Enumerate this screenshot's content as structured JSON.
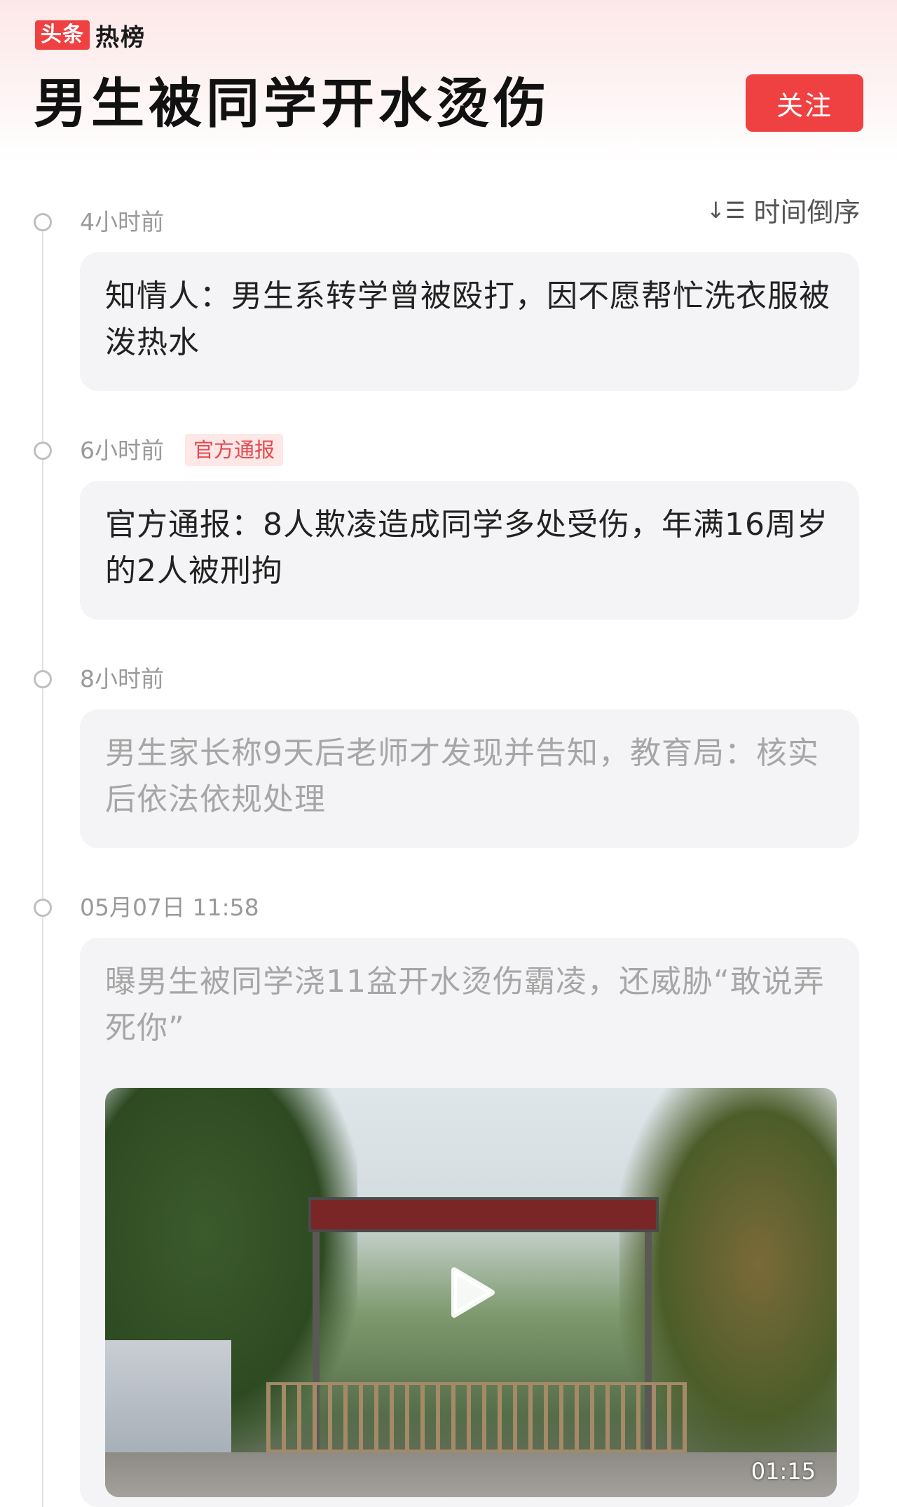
{
  "brand": {
    "tag": "头条",
    "name": "热榜"
  },
  "header": {
    "title": "男生被同学开水烫伤",
    "follow_label": "关注"
  },
  "sort": {
    "label": "时间倒序"
  },
  "timeline": [
    {
      "time": "4小时前",
      "text": "知情人：男生系转学曾被殴打，因不愿帮忙洗衣服被泼热水"
    },
    {
      "time": "6小时前",
      "tag": "官方通报",
      "text": "官方通报：8人欺凌造成同学多处受伤，年满16周岁的2人被刑拘"
    },
    {
      "time": "8小时前",
      "text": "男生家长称9天后老师才发现并告知，教育局：核实后依法依规处理"
    },
    {
      "time": "05月07日 11:58",
      "text": "曝男生被同学浇11盆开水烫伤霸凌，还威胁“敢说弄死你”",
      "video": {
        "duration": "01:15"
      }
    }
  ],
  "colors": {
    "accent": "#f04142",
    "card_bg": "#f4f4f6",
    "read_text": "#a6a6a6"
  }
}
